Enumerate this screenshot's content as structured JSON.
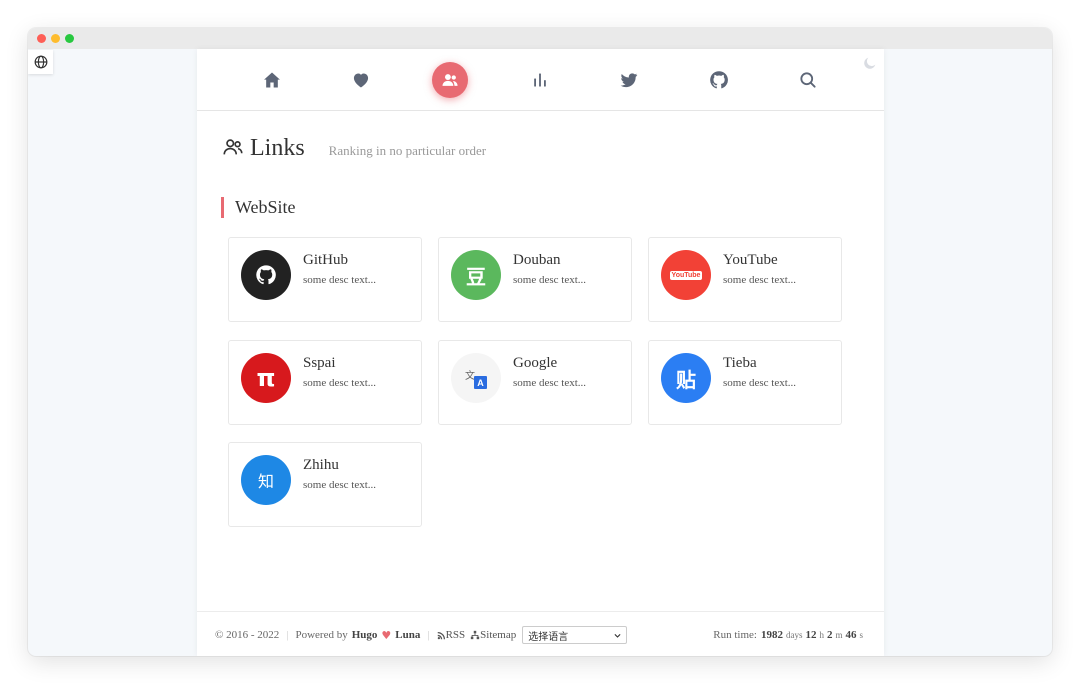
{
  "nav": {
    "items": [
      {
        "icon": "home-icon"
      },
      {
        "icon": "heart-icon"
      },
      {
        "icon": "users-icon",
        "active": true
      },
      {
        "icon": "bar-chart-icon"
      },
      {
        "icon": "twitter-icon"
      },
      {
        "icon": "github-icon"
      },
      {
        "icon": "search-icon"
      }
    ]
  },
  "heading": {
    "title": "Links",
    "subtitle": "Ranking in no particular order"
  },
  "section": {
    "title": "WebSite"
  },
  "links": [
    {
      "name": "GitHub",
      "desc": "some desc text...",
      "color": "#222222",
      "glyph": ""
    },
    {
      "name": "Douban",
      "desc": "some desc text...",
      "color": "#5bb85d",
      "glyph": "豆"
    },
    {
      "name": "YouTube",
      "desc": "some desc text...",
      "color": "#f24136",
      "glyph": "YouTube"
    },
    {
      "name": "Sspai",
      "desc": "some desc text...",
      "color": "#d7191d",
      "glyph": "π"
    },
    {
      "name": "Google",
      "desc": "some desc text...",
      "color": "#f5f5f5",
      "glyph": "A"
    },
    {
      "name": "Tieba",
      "desc": "some desc text...",
      "color": "#2b7ef3",
      "glyph": "贴"
    },
    {
      "name": "Zhihu",
      "desc": "some desc text...",
      "color": "#1e88e5",
      "glyph": "知"
    }
  ],
  "footer": {
    "copyright": "© 2016 - 2022",
    "powered_by": "Powered by",
    "hugo": "Hugo",
    "luna": "Luna",
    "rss": "RSS",
    "sitemap": "Sitemap",
    "language": "选择语言",
    "runtime_label": "Run time:",
    "days": "1982",
    "days_unit": "days",
    "hours": "12",
    "hours_unit": "h",
    "minutes": "2",
    "minutes_unit": "m",
    "seconds": "46",
    "seconds_unit": "s"
  },
  "colors": {
    "accent": "#e86a72",
    "nav_icon": "#5d6677"
  }
}
